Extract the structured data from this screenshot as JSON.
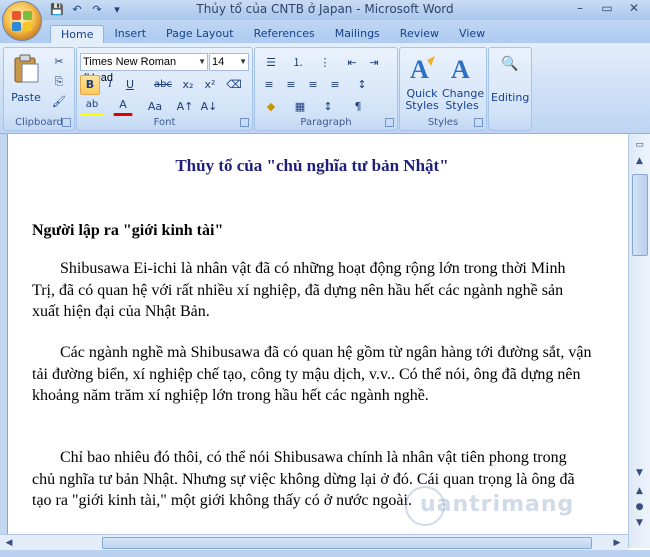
{
  "window": {
    "title": "Thủy tổ của CNTB ở Japan - Microsoft Word",
    "minimize": "–",
    "maximize": "▭",
    "close": "✕"
  },
  "qat": {
    "save": "💾",
    "undo": "↶",
    "redo": "↷",
    "more": "▾"
  },
  "tabs": [
    {
      "label": "Home",
      "active": true
    },
    {
      "label": "Insert"
    },
    {
      "label": "Page Layout"
    },
    {
      "label": "References"
    },
    {
      "label": "Mailings"
    },
    {
      "label": "Review"
    },
    {
      "label": "View"
    }
  ],
  "clipboard": {
    "label": "Clipboard",
    "paste": "Paste",
    "cut": "✂",
    "copy": "⎘",
    "format_painter": "🖌"
  },
  "font": {
    "label": "Font",
    "name": "Times New Roman (Head",
    "size": "14",
    "bold": "B",
    "italic": "I",
    "underline": "U",
    "strike": "abc",
    "subscript": "x₂",
    "superscript": "x²",
    "clear": "⌫",
    "highlight": "ab",
    "font_color": "A",
    "change_case": "Aa",
    "grow": "A↑",
    "shrink": "A↓"
  },
  "paragraph": {
    "label": "Paragraph",
    "bullets": "☰",
    "numbering": "⒈",
    "multilevel": "⋮",
    "decrease_indent": "⇤",
    "increase_indent": "⇥",
    "sort": "↕",
    "show_marks": "¶",
    "align_left": "≡",
    "center": "≡",
    "align_right": "≡",
    "justify": "≡",
    "line_spacing": "↕",
    "shading": "◆",
    "borders": "▦"
  },
  "styles": {
    "label": "Styles",
    "quick_styles": "Quick Styles",
    "change_styles": "Change Styles",
    "quick_styles_line1": "Quick",
    "quick_styles_line2": "Styles",
    "change_styles_line1": "Change",
    "change_styles_line2": "Styles"
  },
  "editing": {
    "label": "Editing",
    "icon": "🔍"
  },
  "document": {
    "title": "Thủy tổ của \"chủ nghĩa tư bản Nhật\"",
    "heading": "Người lập ra \"giới kinh tài\"",
    "paragraphs": [
      "Shibusawa Ei-ichi là nhân vật đã có những hoạt động rộng lớn trong thời Minh Trị, đã có quan hệ với rất nhiều xí nghiệp, đã dựng nên hầu hết các ngành nghề sản xuất hiện đại của Nhật Bản.",
      "Các ngành nghề mà Shibusawa đã có quan hệ gồm từ ngân hàng tới đường sắt, vận tải đường biển, xí nghiệp chế tạo, công ty mậu dịch, v.v.. Có thể nói, ông đã dựng nên khoảng năm trăm xí nghiệp lớn trong hầu hết các ngành nghề.",
      "Chỉ bao nhiêu đó thôi, có thể nói Shibusawa chính là nhân vật tiên phong trong chủ nghĩa tư bản Nhật. Nhưng sự việc không dừng lại ở đó. Cái quan trọng là ông đã tạo ra \"giới kinh tài,\" một giới không thấy có ở nước ngoài."
    ]
  },
  "watermark": "uantrimang",
  "colors": {
    "accent": "#15428b",
    "title_text": "#1f1f7a",
    "highlight": "#ffff00",
    "font_color": "#e00000"
  }
}
